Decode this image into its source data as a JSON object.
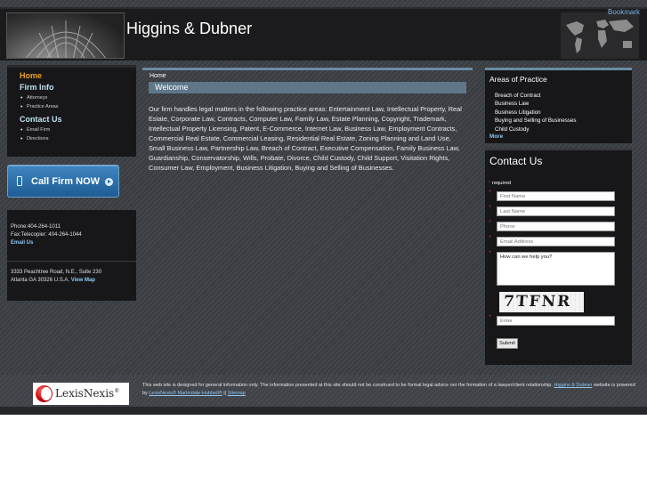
{
  "header": {
    "title": "Higgins & Dubner",
    "bookmark_label": "Bookmark"
  },
  "left_nav": {
    "home": "Home",
    "firm_info": "Firm Info",
    "firm_info_items": [
      "Attorneys",
      "Practice Areas"
    ],
    "contact_us": "Contact Us",
    "contact_items": [
      "Email Firm",
      "Directions"
    ]
  },
  "call_button": {
    "label": "Call Firm NOW",
    "icons": [
      "phone-icon",
      "play-circle-icon"
    ]
  },
  "contact_info": {
    "phone": "Phone:404-264-1011",
    "fax": "Fax:Telecopier: 404-264-1044",
    "email_link": "Email Us",
    "address_line1": "3333 Peachtree Road, N.E., Suite 230",
    "address_line2": "Atlanta GA 30326 U.S.A.",
    "view_map_link": "View Map"
  },
  "main": {
    "breadcrumb": "Home",
    "heading": "Welcome",
    "body": "Our firm handles legal matters in the following practice areas: Entertainment Law, Intellectual Property, Real Estate, Corporate Law, Contracts, Computer Law, Family Law, Estate Planning, Copyright, Trademark, Intellectual Property Licensing, Patent, E-Commerce, Internet Law, Business Law, Employment Contracts, Commercial Real Estate, Commercial Leasing, Residential Real Estate, Zoning Planning and Land Use, Small Business Law, Partnership Law, Breach of Contract, Executive Compensation, Family Business Law, Guardianship, Conservatorship, Wills, Probate, Divorce, Child Custody, Child Support, Visitation Rights, Consumer Law, Employment, Business Litigation, Buying and Selling of Businesses."
  },
  "practice_areas": {
    "title": "Areas of Practice",
    "items": [
      "Breach of Contract",
      "Business Law",
      "Business Litigation",
      "Buying and Selling of Businesses",
      "Child Custody"
    ],
    "more_link": "More"
  },
  "contact_form": {
    "title": "Contact Us",
    "required_note": "required",
    "first_name": "First Name",
    "last_name": "Last Name",
    "phone": "Phone",
    "email": "Email Address",
    "message": "How can we help you?",
    "captcha_text": "7TFNR",
    "captcha_input": "Enter",
    "submit_label": "Submit"
  },
  "footer": {
    "logo_text": "LexisNexis",
    "logo_reg": "®",
    "disclaimer": "This web site is designed for general information only. The information presented at this site should not be construed to be formal legal advice nor the formation of a lawyer/client relationship.",
    "firm_link": "Higgins & Dubner",
    "powered_text": "website is powered by",
    "lexis_link": "LexisNexis® Martindale-Hubbell®",
    "separator": "||",
    "sitemap_link": "Sitemap"
  },
  "colors": {
    "accent_orange": "#f0a020",
    "link_blue": "#8ec6f0",
    "welcome_bar": "#5f7789",
    "call_button": "#2a6ca8"
  }
}
